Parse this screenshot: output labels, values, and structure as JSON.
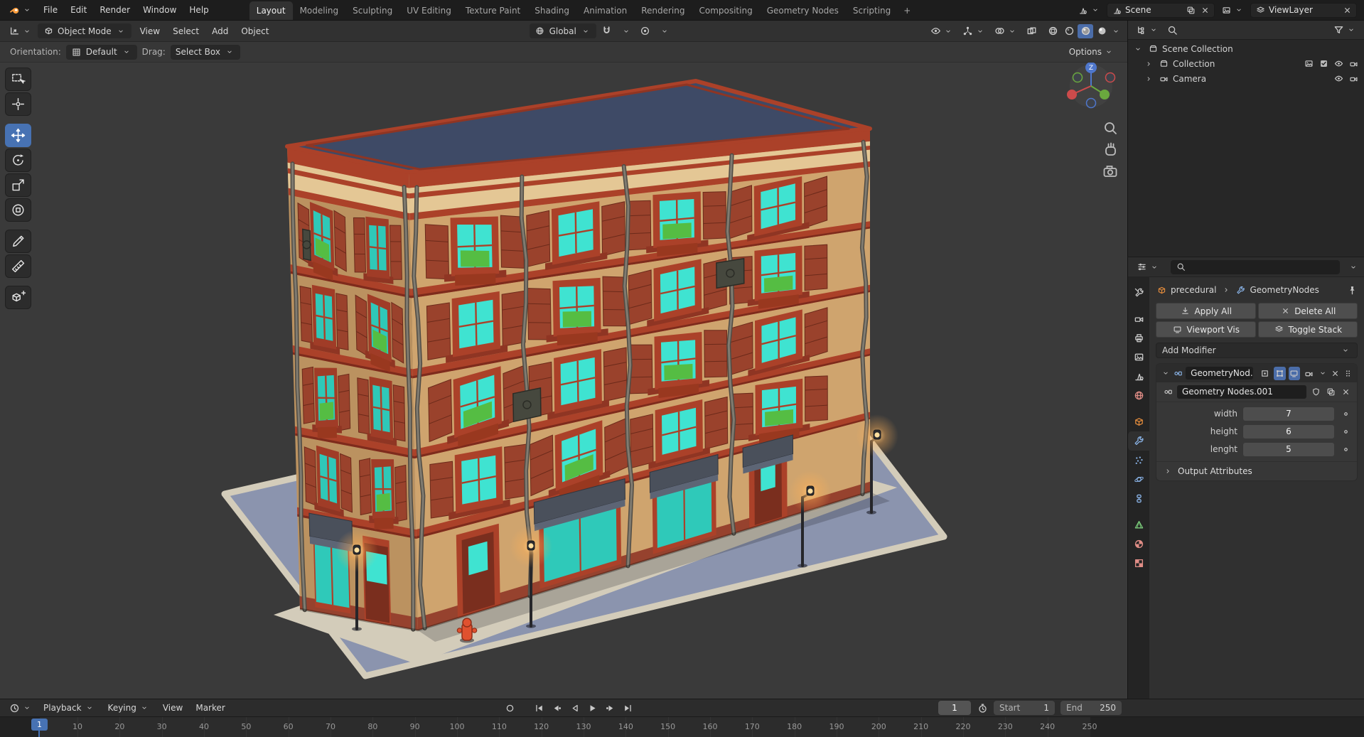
{
  "topbar": {
    "menus": [
      "File",
      "Edit",
      "Render",
      "Window",
      "Help"
    ],
    "workspaces": [
      "Layout",
      "Modeling",
      "Sculpting",
      "UV Editing",
      "Texture Paint",
      "Shading",
      "Animation",
      "Rendering",
      "Compositing",
      "Geometry Nodes",
      "Scripting"
    ],
    "active_workspace": "Layout",
    "add_workspace_label": "+",
    "scene_name": "Scene",
    "view_layer_name": "ViewLayer"
  },
  "viewport": {
    "header": {
      "mode": "Object Mode",
      "menus": [
        "View",
        "Select",
        "Add",
        "Object"
      ],
      "orientation": "Global"
    },
    "tool_settings": {
      "orientation_label": "Orientation:",
      "orientation_value": "Default",
      "drag_label": "Drag:",
      "drag_value": "Select Box",
      "options_label": "Options"
    },
    "tools": [
      "select-box",
      "cursor",
      "move",
      "rotate",
      "scale",
      "transform",
      "annotate",
      "measure",
      "add-cube"
    ],
    "active_tool": "move",
    "gizmo_axis_label": "Z",
    "colors": {
      "wall": "#cfa46e",
      "wall_shade": "#bb9260",
      "trim": "#ab4129",
      "trim_dark": "#7e2b1c",
      "glass": "#3fe3d1",
      "roof": "#3e4a66",
      "cornice": "#e4c795",
      "ground": "#8b94ae",
      "sidewalk": "#d3ccba",
      "pipe": "#807b70",
      "awning": "#4a505b",
      "hydrant": "#e0512f",
      "plant": "#55bd43",
      "accent": "#4772b3"
    }
  },
  "outliner": {
    "rows": [
      {
        "label": "Scene Collection",
        "depth": 0,
        "icon": "coll",
        "arrow": "down",
        "right": []
      },
      {
        "label": "Collection",
        "depth": 1,
        "icon": "coll",
        "arrow": "right",
        "right": [
          {
            "icon": "photo",
            "name": "collection-image-icon"
          },
          {
            "icon": "check",
            "name": "exclude-checkbox"
          },
          {
            "icon": "eye",
            "name": "hide-viewport-eye-icon"
          },
          {
            "icon": "cam",
            "name": "disable-render-camera-icon"
          }
        ]
      },
      {
        "label": "Camera",
        "depth": 1,
        "icon": "cam",
        "arrow": "right",
        "right": [
          {
            "icon": "eye",
            "name": "hide-viewport-eye-icon"
          },
          {
            "icon": "cam",
            "name": "disable-render-camera-icon"
          }
        ]
      }
    ]
  },
  "properties": {
    "breadcrumb": {
      "object": "precedural",
      "modifier": "GeometryNodes"
    },
    "action_buttons": [
      {
        "label": "Apply All",
        "icon": "applyall"
      },
      {
        "label": "Delete All",
        "icon": "x"
      },
      {
        "label": "Viewport Vis",
        "icon": "tv"
      },
      {
        "label": "Toggle Stack",
        "icon": "layers"
      }
    ],
    "add_modifier_label": "Add Modifier",
    "modifier": {
      "name": "GeometryNod...",
      "node_group": "Geometry Nodes.001",
      "inputs": [
        {
          "label": "width",
          "value": "7"
        },
        {
          "label": "height",
          "value": "6"
        },
        {
          "label": "lenght",
          "value": "5"
        }
      ],
      "output_section_label": "Output Attributes"
    },
    "tabs": [
      {
        "name": "tool",
        "icon": "tool"
      },
      {
        "name": "render",
        "icon": "cam"
      },
      {
        "name": "output",
        "icon": "printer"
      },
      {
        "name": "view-layer",
        "icon": "photo"
      },
      {
        "name": "scene",
        "icon": "scene"
      },
      {
        "name": "world",
        "icon": "globe",
        "tint": "red"
      },
      {
        "name": "object",
        "icon": "cube",
        "tint": "orange"
      },
      {
        "name": "modifiers",
        "icon": "wrench",
        "tint": "blue"
      },
      {
        "name": "particles",
        "icon": "particles",
        "tint": "blue"
      },
      {
        "name": "physics",
        "icon": "physics",
        "tint": "blue"
      },
      {
        "name": "constraints",
        "icon": "constraint",
        "tint": "blue"
      },
      {
        "name": "object-data",
        "icon": "meshdata",
        "tint": "green"
      },
      {
        "name": "material",
        "icon": "material",
        "tint": "red"
      },
      {
        "name": "texture",
        "icon": "checker",
        "tint": "red"
      }
    ],
    "active_tab": "modifiers"
  },
  "timeline": {
    "menus": [
      "Playback",
      "Keying",
      "View",
      "Marker"
    ],
    "current_frame": "1",
    "playhead_label": "1",
    "start_label": "Start",
    "start_value": "1",
    "end_label": "End",
    "end_value": "250",
    "ticks": [
      10,
      20,
      30,
      40,
      50,
      60,
      70,
      80,
      90,
      100,
      110,
      120,
      130,
      140,
      150,
      160,
      170,
      180,
      190,
      200,
      210,
      220,
      230,
      240,
      250
    ]
  }
}
